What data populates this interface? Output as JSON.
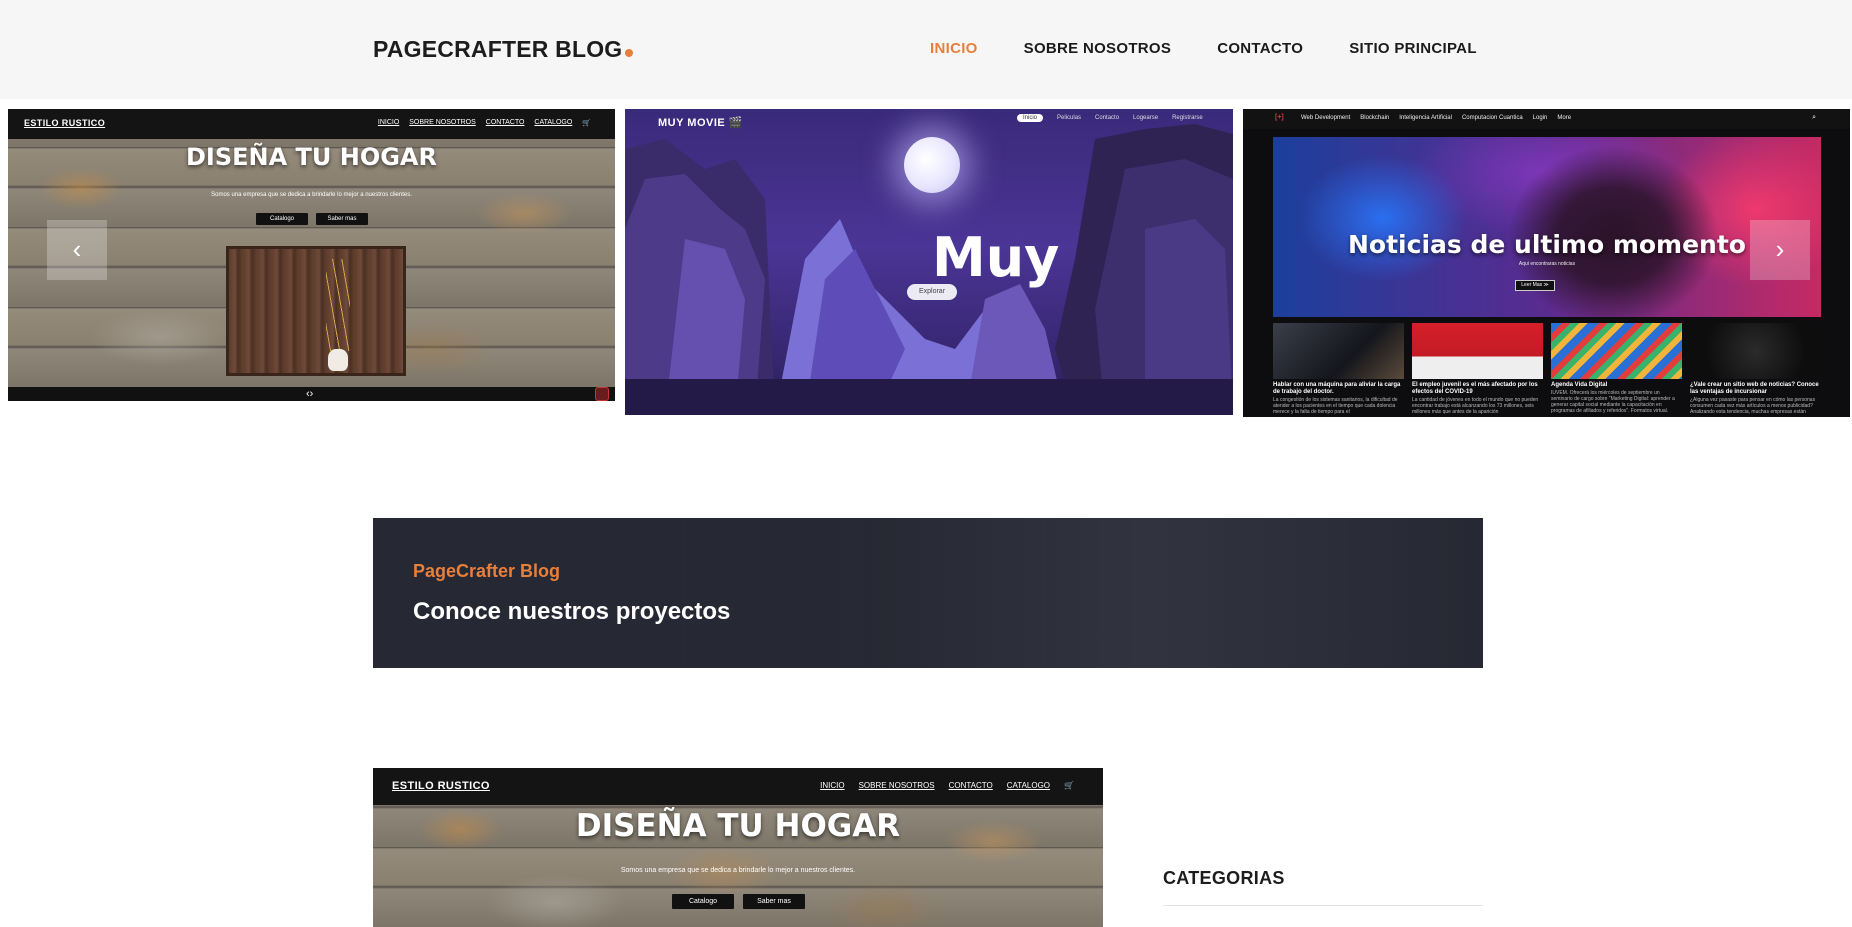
{
  "header": {
    "logo": "PAGECRAFTER BLOG",
    "nav": [
      "INICIO",
      "SOBRE NOSOTROS",
      "CONTACTO",
      "SITIO PRINCIPAL"
    ],
    "accent": "#e87f3b"
  },
  "carousel": {
    "prev_glyph": "‹",
    "next_glyph": "›",
    "slide1": {
      "brand": "ESTILO RUSTICO",
      "nav": [
        "INICIO",
        "SOBRE NOSOTROS",
        "CONTACTO",
        "CATALOGO"
      ],
      "cart_icon": "🛒",
      "title": "DISEÑA TU HOGAR",
      "subtitle": "Somos una empresa que se dedica a brindarle lo mejor a nuestros clientes.",
      "btn_primary": "Catalogo",
      "btn_secondary": "Saber mas",
      "footer_arrows": "‹›"
    },
    "slide2": {
      "brand": "MUY MOVIE 🎬",
      "nav": [
        "Inicio",
        "Peliculas",
        "Contacto",
        "Logearse",
        "Registrarse"
      ],
      "title": "Muy",
      "cta": "Explorar"
    },
    "slide3": {
      "logo": "[+]",
      "nav": [
        "Web Development",
        "Blockchain",
        "Inteligencia Artificial",
        "Computacion Cuantica",
        "Login",
        "More"
      ],
      "search_icon": "⌕",
      "title": "Noticias de ultimo momento",
      "subtitle": "Aqui encontraras noticias",
      "cta": "Leer Mas ≫",
      "cards": [
        {
          "title": "Hablar con una máquina para aliviar la carga de trabajo del doctor.",
          "text": "La congestión de los sistemas sanitarios, la dificultad de atender a los pacientes en el tiempo que cada dolencia merece y la falta de tiempo para el"
        },
        {
          "title": "El empleo juvenil es el más afectado por los efectos del COVID-19",
          "text": "La cantidad de jóvenes en todo el mundo que no pueden encontrar trabajo está alcanzando los 73 millones, seis millones más que antes de la aparición"
        },
        {
          "title": "Agenda Vida Digital",
          "text": "IUVEM. Ofrecerá los miércoles de septiembre un seminario de cargo sobre \"Marketing Digital: aprender a generar capital social mediante la capacitación en programas de afiliados y referidos\". Formatos virtual."
        },
        {
          "title": "¿Vale crear un sitio web de noticias? Conoce las ventajas de incursionar",
          "text": "¿Alguna vez pasaste para pensar en cómo las personas consumen cada vez más artículos a menos publicidad? Analizando esta tendencia, muchas empresas están"
        }
      ]
    }
  },
  "banner": {
    "kicker": "PageCrafter Blog",
    "title": "Conoce nuestros proyectos"
  },
  "post": {
    "brand": "ESTILO RUSTICO",
    "nav": [
      "INICIO",
      "SOBRE NOSOTROS",
      "CONTACTO",
      "CATALOGO"
    ],
    "cart_icon": "🛒",
    "title": "DISEÑA TU HOGAR",
    "subtitle": "Somos una empresa que se dedica a brindarle lo mejor a nuestros clientes.",
    "btn_primary": "Catalogo",
    "btn_secondary": "Saber mas"
  },
  "sidebar": {
    "title": "CATEGORIAS"
  }
}
